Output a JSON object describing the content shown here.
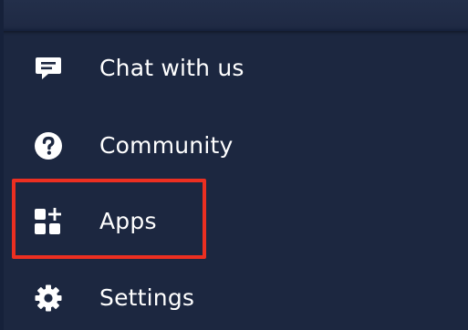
{
  "menu": {
    "items": [
      {
        "key": "chat",
        "label": "Chat with us",
        "icon": "chat-bubble-icon"
      },
      {
        "key": "community",
        "label": "Community",
        "icon": "help-circle-icon"
      },
      {
        "key": "apps",
        "label": "Apps",
        "icon": "apps-add-icon"
      },
      {
        "key": "settings",
        "label": "Settings",
        "icon": "gear-icon"
      }
    ]
  },
  "colors": {
    "background": "#1c2740",
    "text": "#ffffff",
    "highlight": "#ec2f21"
  }
}
